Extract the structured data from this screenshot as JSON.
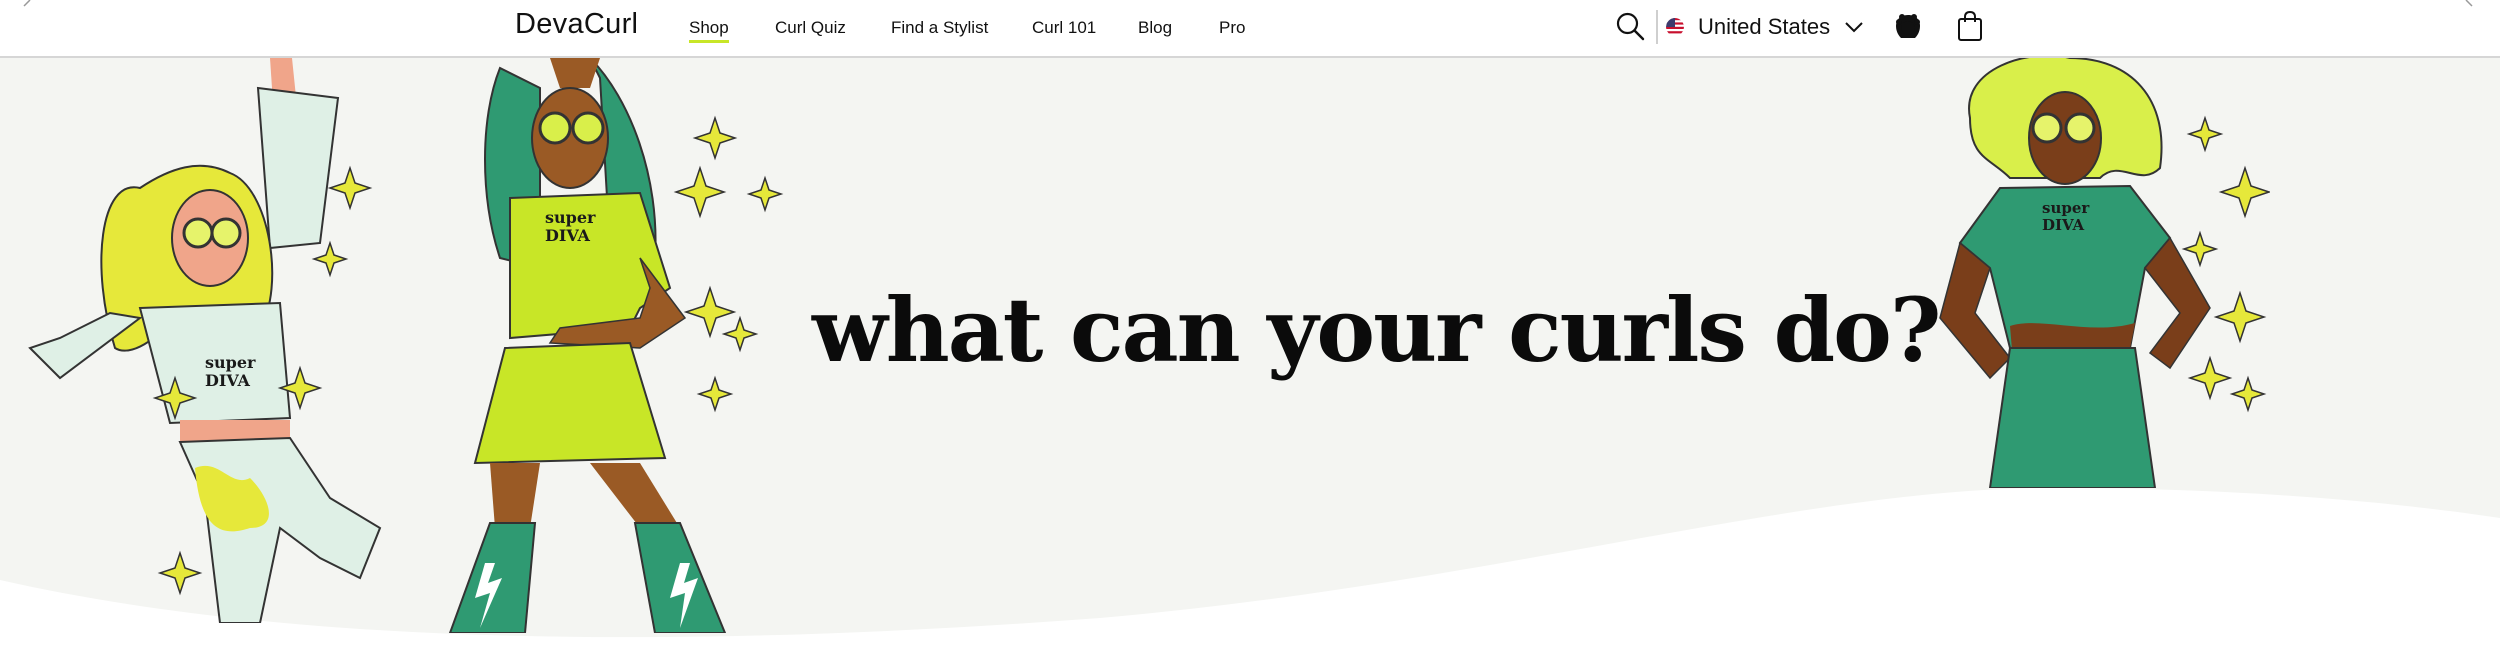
{
  "brand": {
    "logo_text": "DevaCurl"
  },
  "nav": {
    "items": [
      {
        "label": "Shop",
        "active": true
      },
      {
        "label": "Curl Quiz",
        "active": false
      },
      {
        "label": "Find a Stylist",
        "active": false
      },
      {
        "label": "Curl 101",
        "active": false
      },
      {
        "label": "Blog",
        "active": false
      },
      {
        "label": "Pro",
        "active": false
      }
    ]
  },
  "header": {
    "region_label": "United States",
    "icons": [
      "search-icon",
      "us-flag-icon",
      "chevron-down-icon",
      "account-icon",
      "shopping-bag-icon"
    ]
  },
  "hero": {
    "headline": "what can your curls do?",
    "characters": [
      "left-dancer",
      "center-dancer",
      "right-dancer"
    ],
    "shirt_text": "super DIVA"
  },
  "colors": {
    "accent_lime": "#c8e627",
    "teal_green": "#2f9a72",
    "hero_bg": "#f4f5f2",
    "text": "#111111"
  }
}
